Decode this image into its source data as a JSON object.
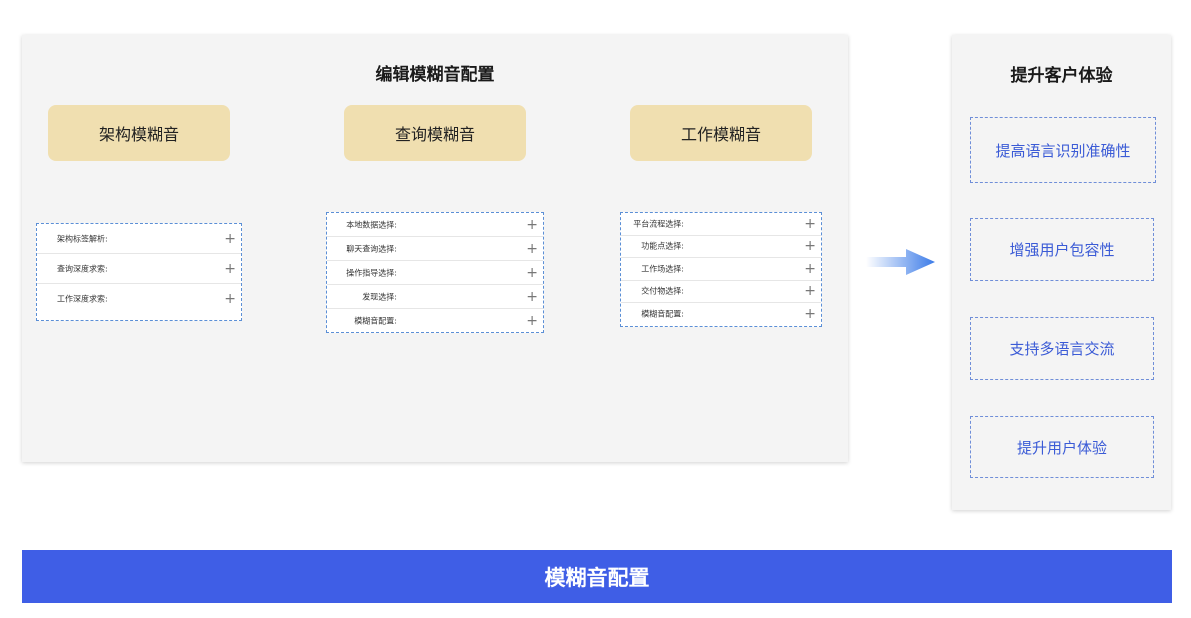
{
  "editor": {
    "title": "编辑模糊音配置",
    "categories": [
      {
        "label": "架构模糊音",
        "items": [
          "架构标签解析:",
          "查询深度求索:",
          "工作深度求索:"
        ]
      },
      {
        "label": "查询模糊音",
        "items": [
          "本地数据选择:",
          "聊天查询选择:",
          "操作指导选择:",
          "发现选择:",
          "模糊音配置:"
        ]
      },
      {
        "label": "工作模糊音",
        "items": [
          "平台流程选择:",
          "功能点选择:",
          "工作场选择:",
          "交付物选择:",
          "模糊音配置:"
        ]
      }
    ],
    "add_symbol": "+"
  },
  "benefits": {
    "title": "提升客户体验",
    "items": [
      "提高语言识别准确性",
      "增强用户包容性",
      "支持多语言交流",
      "提升用户体验"
    ]
  },
  "footer": {
    "label": "模糊音配置"
  },
  "colors": {
    "category_fill": "#f0dfb0",
    "dashed_border": "#5b8fd6",
    "benefit_text": "#3b5bd6",
    "footer_bg": "#3f5ee6",
    "panel_bg": "#f4f4f4"
  }
}
